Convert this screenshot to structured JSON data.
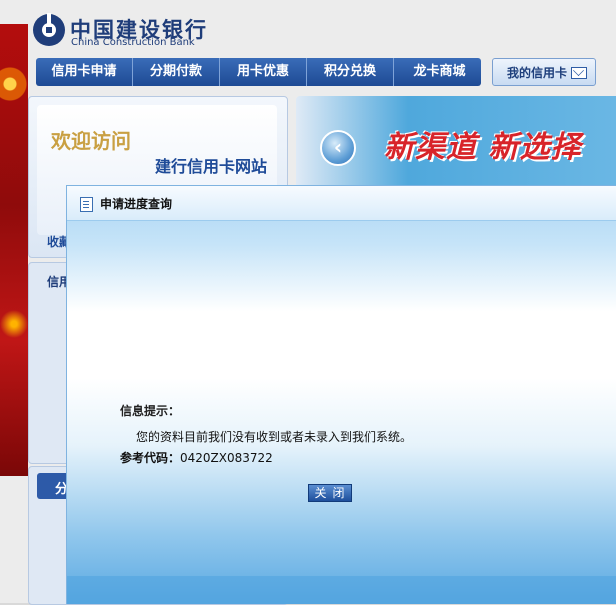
{
  "header": {
    "bank_name_cn": "中国建设银行",
    "bank_name_en": "China Construction Bank"
  },
  "nav": {
    "items": [
      {
        "label": "信用卡申请"
      },
      {
        "label": "分期付款"
      },
      {
        "label": "用卡优惠"
      },
      {
        "label": "积分兑换"
      },
      {
        "label": "龙卡商城"
      }
    ],
    "my_card": "我的信用卡"
  },
  "welcome": {
    "line1": "欢迎访问",
    "line2": "建行信用卡网站",
    "fav": "收藏"
  },
  "side": {
    "credit": "信用",
    "installment": "分"
  },
  "banner": {
    "title": "新渠道 新选择",
    "arrow": "‹"
  },
  "modal": {
    "title": "申请进度查询",
    "info_label": "信息提示：",
    "message": "您的资料目前我们没有收到或者未录入到我们系统。",
    "ref_label": "参考代码：",
    "ref_code": "0420ZX083722",
    "close_label": "关闭"
  },
  "colors": {
    "nav_blue": "#1e4a94",
    "brand_blue": "#1f3d7a",
    "banner_red": "#d8242a"
  }
}
